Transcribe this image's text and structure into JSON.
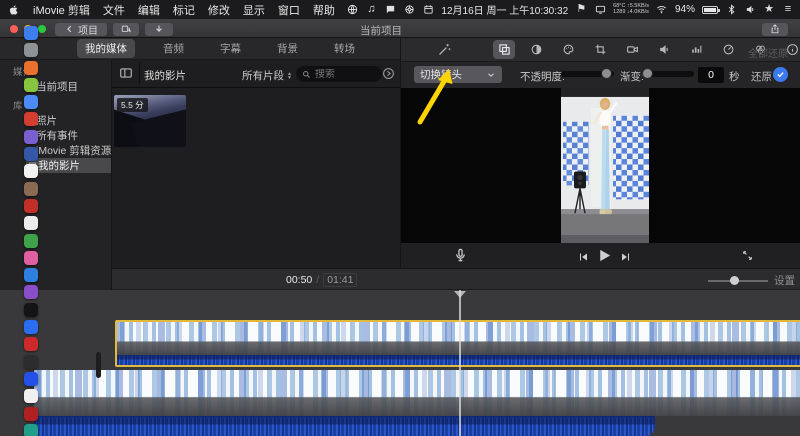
{
  "menubar": {
    "items": [
      "iMovie 剪辑",
      "文件",
      "编辑",
      "标记",
      "修改",
      "显示",
      "窗口",
      "帮助"
    ],
    "date": "12月16日 周一 上午10:30:32",
    "net1": "68°C ↑5.5KB/s",
    "net2": "1289 ↓4.0KB/s",
    "battery": "94%"
  },
  "titlebar": {
    "back": "项目",
    "title": "当前项目"
  },
  "tabs": [
    {
      "label": "我的媒体",
      "selected": true
    },
    {
      "label": "音频"
    },
    {
      "label": "字幕"
    },
    {
      "label": "背景"
    },
    {
      "label": "转场"
    }
  ],
  "sidebar": {
    "items": [
      {
        "label": "媒体",
        "type": "header"
      },
      {
        "label": "当前项目",
        "ic": "☆"
      },
      {
        "label": "库",
        "type": "header"
      },
      {
        "label": "照片",
        "ic": "❀"
      },
      {
        "label": "所有事件",
        "ic": "★"
      },
      {
        "label": "iMovie 剪辑资源库",
        "ic": "◈"
      },
      {
        "label": "我的影片",
        "ic": "▤",
        "selected": true
      }
    ]
  },
  "browser": {
    "title": "我的影片",
    "filter": "所有片段",
    "search_placeholder": "搜索",
    "clip_badge": "5.5 分"
  },
  "inspector": {
    "reset_all": "全部还原",
    "dropdown_value": "切换镜头",
    "opacity_label": "不透明度:",
    "fade_label": "渐变:",
    "duration_value": "0",
    "duration_unit": "秒",
    "reset": "还原",
    "accent_blue": "#3a7bf2",
    "selection_yellow": "#e2b93b",
    "tools": [
      {
        "icon": "overlay",
        "name": "overlay-settings-icon",
        "selected": true
      },
      {
        "icon": "contrast",
        "name": "color-balance-icon"
      },
      {
        "icon": "palette",
        "name": "color-correction-icon"
      },
      {
        "icon": "crop",
        "name": "crop-icon"
      },
      {
        "icon": "camera",
        "name": "stabilization-icon"
      },
      {
        "icon": "speaker",
        "name": "volume-icon"
      },
      {
        "icon": "bars",
        "name": "noise-equalizer-icon"
      },
      {
        "icon": "speed",
        "name": "speed-icon"
      },
      {
        "icon": "circles3",
        "name": "clip-filter-icon"
      },
      {
        "icon": "info",
        "name": "clip-info-icon"
      }
    ]
  },
  "transport": {
    "current": "00:50",
    "separator": "/",
    "total": "01:41",
    "settings": "设置"
  },
  "dock": {
    "icons": [
      {
        "c": "#3d7ff0"
      },
      {
        "c": "#8e9196"
      },
      {
        "c": "#e8712f"
      },
      {
        "c": "#87c440"
      },
      {
        "c": "#4c8bf5"
      },
      {
        "c": "#d23f31"
      },
      {
        "c": "#7a5fd0"
      },
      {
        "c": "#3457a8"
      },
      {
        "c": "#f2f2f2"
      },
      {
        "c": "#8a6a52"
      },
      {
        "c": "#c03028"
      },
      {
        "c": "#ececec"
      },
      {
        "c": "#3fa24a"
      },
      {
        "c": "#e05fa0"
      },
      {
        "c": "#2f7fe0"
      },
      {
        "c": "#8a4fc8"
      },
      {
        "c": "#141416"
      },
      {
        "c": "#2a6df0"
      },
      {
        "c": "#cc2a2a"
      },
      {
        "c": "#2c2c30"
      },
      {
        "c": "#2450e8"
      },
      {
        "c": "#f0f0f0"
      },
      {
        "c": "#b02020"
      },
      {
        "c": "#1f9e8a"
      }
    ]
  }
}
